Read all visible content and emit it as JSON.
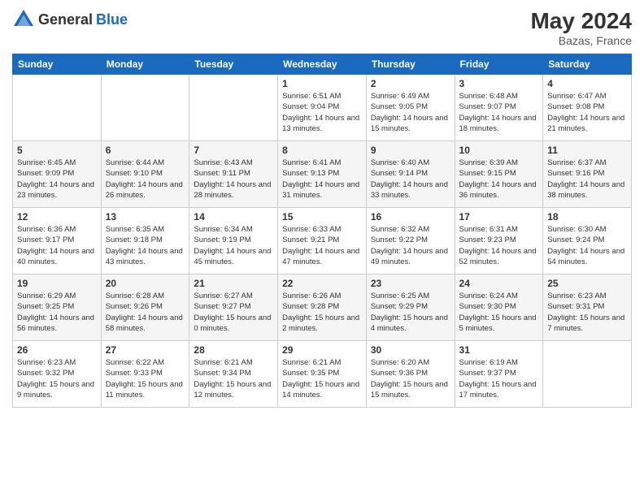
{
  "header": {
    "logo_general": "General",
    "logo_blue": "Blue",
    "month_year": "May 2024",
    "location": "Bazas, France"
  },
  "days_of_week": [
    "Sunday",
    "Monday",
    "Tuesday",
    "Wednesday",
    "Thursday",
    "Friday",
    "Saturday"
  ],
  "weeks": [
    [
      {
        "day": "",
        "info": ""
      },
      {
        "day": "",
        "info": ""
      },
      {
        "day": "",
        "info": ""
      },
      {
        "day": "1",
        "info": "Sunrise: 6:51 AM\nSunset: 9:04 PM\nDaylight: 14 hours and 13 minutes."
      },
      {
        "day": "2",
        "info": "Sunrise: 6:49 AM\nSunset: 9:05 PM\nDaylight: 14 hours and 15 minutes."
      },
      {
        "day": "3",
        "info": "Sunrise: 6:48 AM\nSunset: 9:07 PM\nDaylight: 14 hours and 18 minutes."
      },
      {
        "day": "4",
        "info": "Sunrise: 6:47 AM\nSunset: 9:08 PM\nDaylight: 14 hours and 21 minutes."
      }
    ],
    [
      {
        "day": "5",
        "info": "Sunrise: 6:45 AM\nSunset: 9:09 PM\nDaylight: 14 hours and 23 minutes."
      },
      {
        "day": "6",
        "info": "Sunrise: 6:44 AM\nSunset: 9:10 PM\nDaylight: 14 hours and 26 minutes."
      },
      {
        "day": "7",
        "info": "Sunrise: 6:43 AM\nSunset: 9:11 PM\nDaylight: 14 hours and 28 minutes."
      },
      {
        "day": "8",
        "info": "Sunrise: 6:41 AM\nSunset: 9:13 PM\nDaylight: 14 hours and 31 minutes."
      },
      {
        "day": "9",
        "info": "Sunrise: 6:40 AM\nSunset: 9:14 PM\nDaylight: 14 hours and 33 minutes."
      },
      {
        "day": "10",
        "info": "Sunrise: 6:39 AM\nSunset: 9:15 PM\nDaylight: 14 hours and 36 minutes."
      },
      {
        "day": "11",
        "info": "Sunrise: 6:37 AM\nSunset: 9:16 PM\nDaylight: 14 hours and 38 minutes."
      }
    ],
    [
      {
        "day": "12",
        "info": "Sunrise: 6:36 AM\nSunset: 9:17 PM\nDaylight: 14 hours and 40 minutes."
      },
      {
        "day": "13",
        "info": "Sunrise: 6:35 AM\nSunset: 9:18 PM\nDaylight: 14 hours and 43 minutes."
      },
      {
        "day": "14",
        "info": "Sunrise: 6:34 AM\nSunset: 9:19 PM\nDaylight: 14 hours and 45 minutes."
      },
      {
        "day": "15",
        "info": "Sunrise: 6:33 AM\nSunset: 9:21 PM\nDaylight: 14 hours and 47 minutes."
      },
      {
        "day": "16",
        "info": "Sunrise: 6:32 AM\nSunset: 9:22 PM\nDaylight: 14 hours and 49 minutes."
      },
      {
        "day": "17",
        "info": "Sunrise: 6:31 AM\nSunset: 9:23 PM\nDaylight: 14 hours and 52 minutes."
      },
      {
        "day": "18",
        "info": "Sunrise: 6:30 AM\nSunset: 9:24 PM\nDaylight: 14 hours and 54 minutes."
      }
    ],
    [
      {
        "day": "19",
        "info": "Sunrise: 6:29 AM\nSunset: 9:25 PM\nDaylight: 14 hours and 56 minutes."
      },
      {
        "day": "20",
        "info": "Sunrise: 6:28 AM\nSunset: 9:26 PM\nDaylight: 14 hours and 58 minutes."
      },
      {
        "day": "21",
        "info": "Sunrise: 6:27 AM\nSunset: 9:27 PM\nDaylight: 15 hours and 0 minutes."
      },
      {
        "day": "22",
        "info": "Sunrise: 6:26 AM\nSunset: 9:28 PM\nDaylight: 15 hours and 2 minutes."
      },
      {
        "day": "23",
        "info": "Sunrise: 6:25 AM\nSunset: 9:29 PM\nDaylight: 15 hours and 4 minutes."
      },
      {
        "day": "24",
        "info": "Sunrise: 6:24 AM\nSunset: 9:30 PM\nDaylight: 15 hours and 5 minutes."
      },
      {
        "day": "25",
        "info": "Sunrise: 6:23 AM\nSunset: 9:31 PM\nDaylight: 15 hours and 7 minutes."
      }
    ],
    [
      {
        "day": "26",
        "info": "Sunrise: 6:23 AM\nSunset: 9:32 PM\nDaylight: 15 hours and 9 minutes."
      },
      {
        "day": "27",
        "info": "Sunrise: 6:22 AM\nSunset: 9:33 PM\nDaylight: 15 hours and 11 minutes."
      },
      {
        "day": "28",
        "info": "Sunrise: 6:21 AM\nSunset: 9:34 PM\nDaylight: 15 hours and 12 minutes."
      },
      {
        "day": "29",
        "info": "Sunrise: 6:21 AM\nSunset: 9:35 PM\nDaylight: 15 hours and 14 minutes."
      },
      {
        "day": "30",
        "info": "Sunrise: 6:20 AM\nSunset: 9:36 PM\nDaylight: 15 hours and 15 minutes."
      },
      {
        "day": "31",
        "info": "Sunrise: 6:19 AM\nSunset: 9:37 PM\nDaylight: 15 hours and 17 minutes."
      },
      {
        "day": "",
        "info": ""
      }
    ]
  ]
}
